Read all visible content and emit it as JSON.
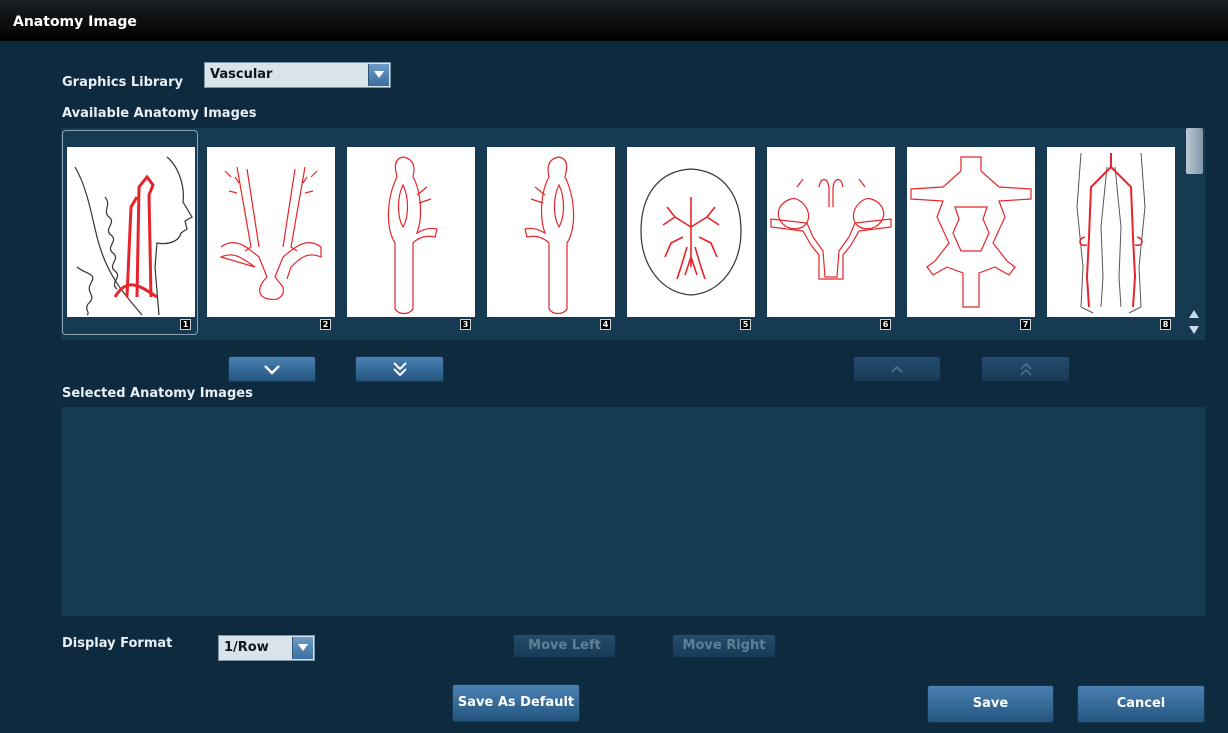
{
  "window": {
    "title": "Anatomy Image"
  },
  "graphics_library": {
    "label": "Graphics Library",
    "value": "Vascular"
  },
  "available": {
    "label": "Available Anatomy Images",
    "items": [
      {
        "number": "1"
      },
      {
        "number": "2"
      },
      {
        "number": "3"
      },
      {
        "number": "4"
      },
      {
        "number": "5"
      },
      {
        "number": "6"
      },
      {
        "number": "7"
      },
      {
        "number": "8"
      }
    ]
  },
  "selected": {
    "label": "Selected Anatomy Images"
  },
  "display_format": {
    "label": "Display Format",
    "value": "1/Row"
  },
  "buttons": {
    "move_left": "Move Left",
    "move_right": "Move Right",
    "save_as_default": "Save As Default",
    "save": "Save",
    "cancel": "Cancel"
  },
  "icons": {
    "add_one": "chevron-down-icon",
    "add_all": "double-chevron-down-icon",
    "remove_one": "chevron-up-icon",
    "remove_all": "double-chevron-up-icon"
  },
  "colors": {
    "vessel": "#e5252b",
    "outline": "#333333",
    "panel": "#0e2a3f",
    "list_bg": "#173a53"
  }
}
